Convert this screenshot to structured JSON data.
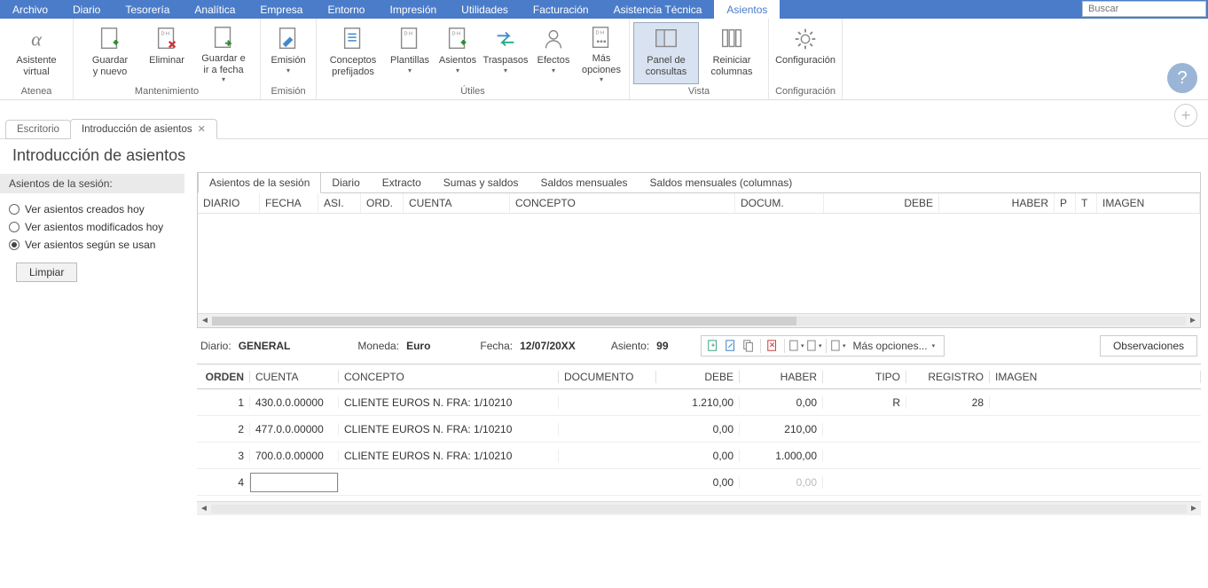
{
  "menu": [
    "Archivo",
    "Diario",
    "Tesorería",
    "Analítica",
    "Empresa",
    "Entorno",
    "Impresión",
    "Utilidades",
    "Facturación",
    "Asistencia Técnica",
    "Asientos"
  ],
  "menu_active": 10,
  "search_placeholder": "Buscar",
  "ribbon": {
    "groups": [
      {
        "label": "Atenea",
        "items": [
          {
            "name": "asistente-virtual",
            "label": "Asistente\nvirtual",
            "icon": "alpha",
            "dd": false
          }
        ]
      },
      {
        "label": "Mantenimiento",
        "items": [
          {
            "name": "guardar-nuevo",
            "label": "Guardar\ny nuevo",
            "icon": "doc-plus",
            "dd": false
          },
          {
            "name": "eliminar",
            "label": "Eliminar",
            "icon": "doc-x",
            "dd": false
          },
          {
            "name": "guardar-ir-fecha",
            "label": "Guardar e\nir a fecha",
            "icon": "doc-arrow",
            "dd": true
          }
        ]
      },
      {
        "label": "Emisión",
        "items": [
          {
            "name": "emision",
            "label": "Emisión",
            "icon": "doc-pencil",
            "dd": true
          }
        ]
      },
      {
        "label": "Útiles",
        "items": [
          {
            "name": "conceptos-prefijados",
            "label": "Conceptos\nprefijados",
            "icon": "doc-lines",
            "dd": false
          },
          {
            "name": "plantillas",
            "label": "Plantillas",
            "icon": "doc-grid",
            "dd": true
          },
          {
            "name": "asientos",
            "label": "Asientos",
            "icon": "doc-dh",
            "dd": true
          },
          {
            "name": "traspasos",
            "label": "Traspasos",
            "icon": "arrows",
            "dd": true
          },
          {
            "name": "efectos",
            "label": "Efectos",
            "icon": "user",
            "dd": true
          },
          {
            "name": "mas-opciones",
            "label": "Más\nopciones",
            "icon": "doc-dots",
            "dd": true
          }
        ]
      },
      {
        "label": "Vista",
        "items": [
          {
            "name": "panel-consultas",
            "label": "Panel de\nconsultas",
            "icon": "panel",
            "dd": false,
            "selected": true
          },
          {
            "name": "reiniciar-columnas",
            "label": "Reiniciar\ncolumnas",
            "icon": "columns",
            "dd": false
          }
        ]
      },
      {
        "label": "Configuración",
        "items": [
          {
            "name": "configuracion",
            "label": "Configuración",
            "icon": "gear",
            "dd": false
          }
        ]
      }
    ]
  },
  "doc_tabs": [
    {
      "label": "Escritorio",
      "closable": false,
      "active": false
    },
    {
      "label": "Introducción de asientos",
      "closable": true,
      "active": true
    }
  ],
  "page_title": "Introducción de asientos",
  "side": {
    "header": "Asientos de la sesión:",
    "options": [
      {
        "label": "Ver asientos creados hoy",
        "checked": false
      },
      {
        "label": "Ver asientos modificados hoy",
        "checked": false
      },
      {
        "label": "Ver asientos según se usan",
        "checked": true
      }
    ],
    "clear_btn": "Limpiar"
  },
  "inner_tabs": [
    "Asientos de la sesión",
    "Diario",
    "Extracto",
    "Sumas y saldos",
    "Saldos mensuales",
    "Saldos mensuales (columnas)"
  ],
  "inner_tab_active": 0,
  "session_cols": [
    "DIARIO",
    "FECHA",
    "ASI.",
    "ORD.",
    "CUENTA",
    "CONCEPTO",
    "DOCUM.",
    "DEBE",
    "HABER",
    "P",
    "T",
    "IMAGEN"
  ],
  "info": {
    "diario_lbl": "Diario:",
    "diario_val": "GENERAL",
    "moneda_lbl": "Moneda:",
    "moneda_val": "Euro",
    "fecha_lbl": "Fecha:",
    "fecha_val": "12/07/20XX",
    "asiento_lbl": "Asiento:",
    "asiento_val": "99",
    "more_opt": "Más opciones...",
    "obs_btn": "Observaciones"
  },
  "entry_cols": {
    "orden": "ORDEN",
    "cuenta": "CUENTA",
    "concepto": "CONCEPTO",
    "documento": "DOCUMENTO",
    "debe": "DEBE",
    "haber": "HABER",
    "tipo": "TIPO",
    "registro": "REGISTRO",
    "imagen": "IMAGEN"
  },
  "entries": [
    {
      "orden": "1",
      "cuenta": "430.0.0.00000",
      "concepto": "CLIENTE EUROS N. FRA:  1/10210",
      "documento": "",
      "debe": "1.210,00",
      "haber": "0,00",
      "tipo": "R",
      "registro": "28",
      "imagen": ""
    },
    {
      "orden": "2",
      "cuenta": "477.0.0.00000",
      "concepto": "CLIENTE EUROS N. FRA:  1/10210",
      "documento": "",
      "debe": "0,00",
      "haber": "210,00",
      "tipo": "",
      "registro": "",
      "imagen": ""
    },
    {
      "orden": "3",
      "cuenta": "700.0.0.00000",
      "concepto": "CLIENTE EUROS N. FRA:  1/10210",
      "documento": "",
      "debe": "0,00",
      "haber": "1.000,00",
      "tipo": "",
      "registro": "",
      "imagen": ""
    },
    {
      "orden": "4",
      "cuenta": "",
      "concepto": "",
      "documento": "",
      "debe": "0,00",
      "haber": "0,00",
      "tipo": "",
      "registro": "",
      "imagen": "",
      "input": true,
      "dim_haber": true
    }
  ]
}
